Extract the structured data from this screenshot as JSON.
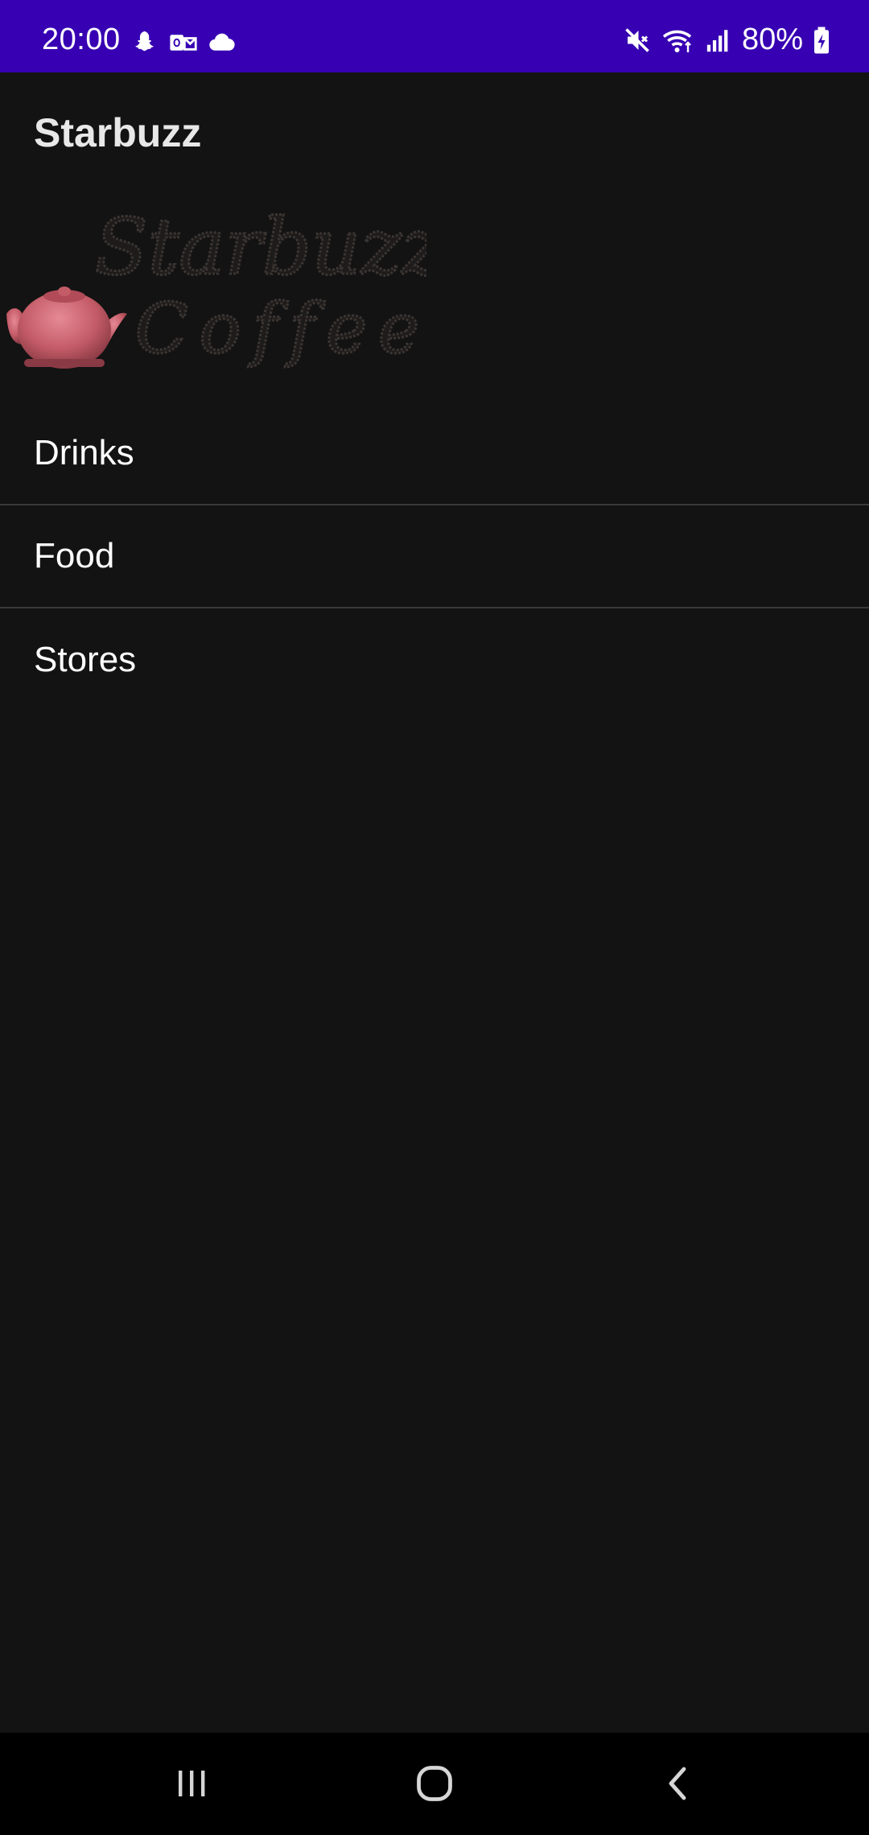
{
  "status_bar": {
    "time": "20:00",
    "battery": "80%",
    "left_icons": [
      "snapchat-icon",
      "outlook-icon",
      "cloud-icon"
    ],
    "right_icons": [
      "mute-icon",
      "wifi-icon",
      "signal-icon",
      "battery-charging-icon"
    ],
    "background": "#3700b3"
  },
  "app_bar": {
    "title": "Starbuzz"
  },
  "logo": {
    "line1": "Starbuzz",
    "line2": "Coffee"
  },
  "menu": {
    "items": [
      {
        "label": "Drinks"
      },
      {
        "label": "Food"
      },
      {
        "label": "Stores"
      }
    ]
  },
  "nav_bar": {
    "buttons": [
      "recents-icon",
      "home-icon",
      "back-icon"
    ]
  }
}
